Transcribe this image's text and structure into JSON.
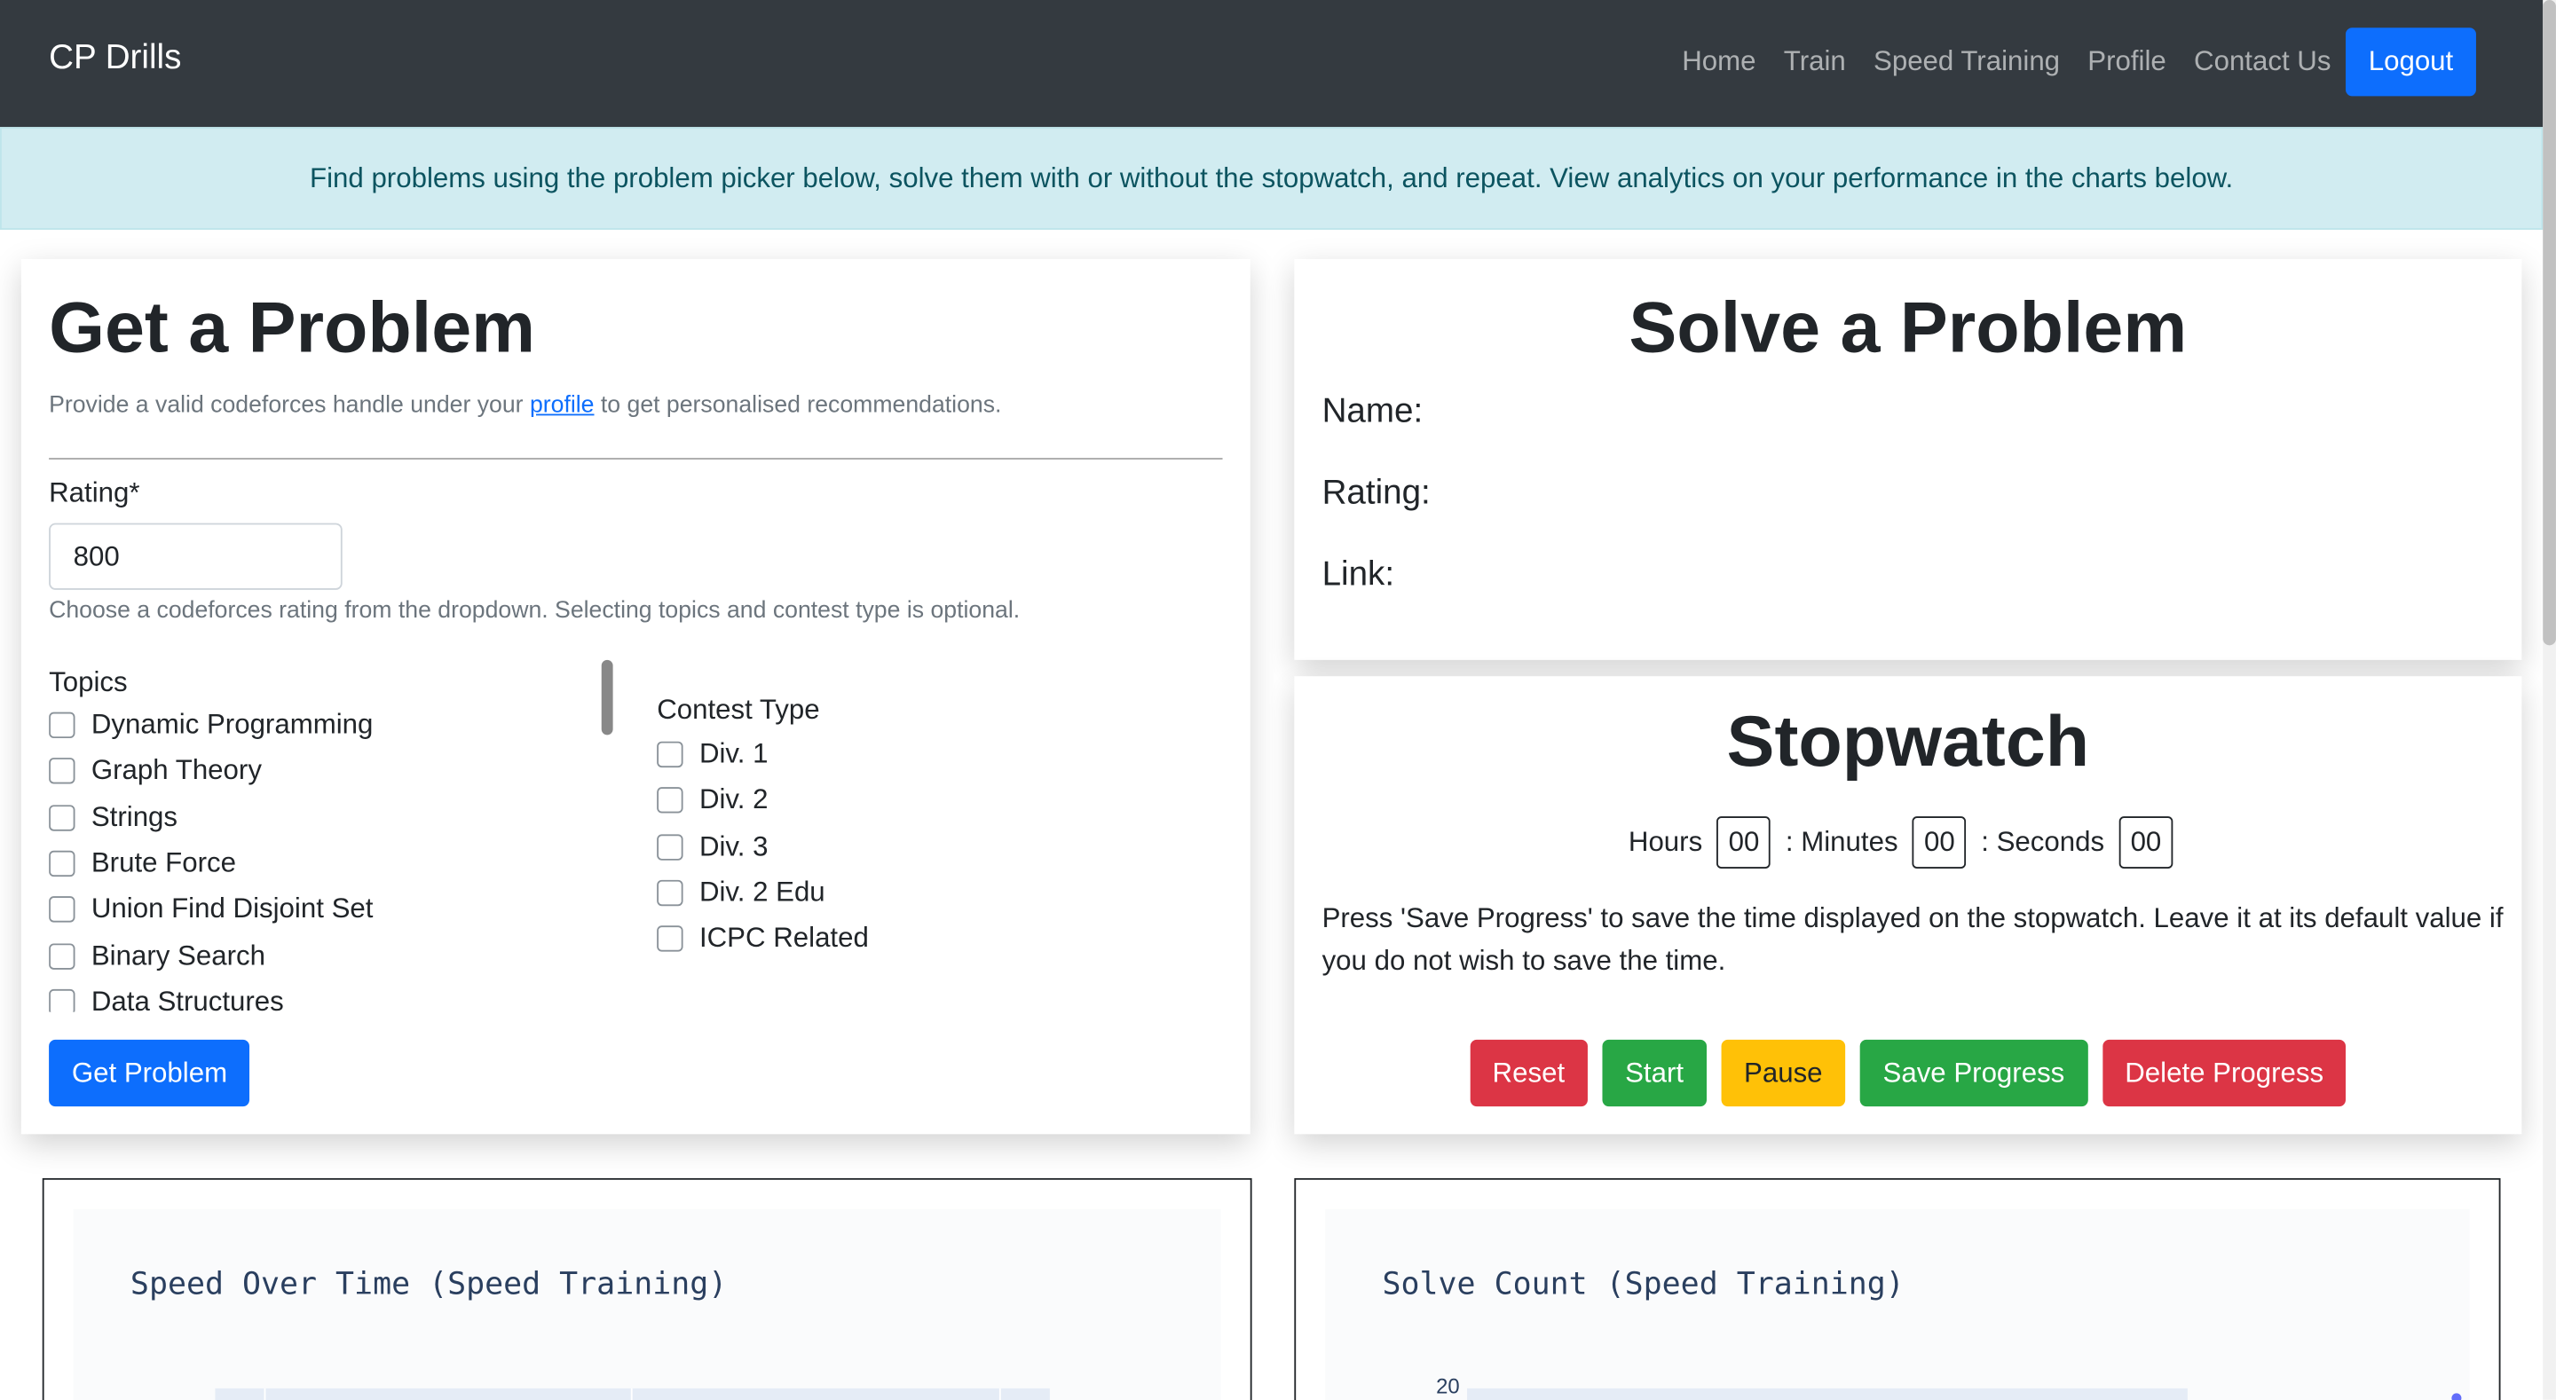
{
  "navbar": {
    "brand": "CP Drills",
    "links": [
      "Home",
      "Train",
      "Speed Training",
      "Profile",
      "Contact Us"
    ],
    "logout_label": "Logout"
  },
  "alert": {
    "text": "Find problems using the problem picker below, solve them with or without the stopwatch, and repeat. View analytics on your performance in the charts below."
  },
  "get_problem": {
    "title": "Get a Problem",
    "subtitle_before": "Provide a valid codeforces handle under your ",
    "subtitle_link": "profile",
    "subtitle_after": " to get personalised recommendations.",
    "rating_label": "Rating*",
    "rating_value": "800",
    "rating_help": "Choose a codeforces rating from the dropdown. Selecting topics and contest type is optional.",
    "topics_label": "Topics",
    "topics": [
      "Dynamic Programming",
      "Graph Theory",
      "Strings",
      "Brute Force",
      "Union Find Disjoint Set",
      "Binary Search",
      "Data Structures"
    ],
    "contest_label": "Contest Type",
    "contest_types": [
      "Div. 1",
      "Div. 2",
      "Div. 3",
      "Div. 2 Edu",
      "ICPC Related"
    ],
    "button_label": "Get Problem"
  },
  "solve_problem": {
    "title": "Solve a Problem",
    "name_label": "Name:",
    "rating_label": "Rating:",
    "link_label": "Link:"
  },
  "stopwatch": {
    "title": "Stopwatch",
    "hours_label": "Hours",
    "hours": "00",
    "minutes_label": ": Minutes",
    "minutes": "00",
    "seconds_label": ": Seconds",
    "seconds": "00",
    "description": "Press 'Save Progress' to save the time displayed on the stopwatch. Leave it at its default value if you do not wish to save the time.",
    "buttons": {
      "reset": "Reset",
      "start": "Start",
      "pause": "Pause",
      "save": "Save Progress",
      "delete": "Delete Progress"
    }
  },
  "charts": [
    {
      "title": "Speed Over Time (Speed Training)"
    },
    {
      "title": "Solve Count (Speed Training)",
      "y_tick_top": "20"
    }
  ],
  "colors": {
    "navbar_bg": "#343a40",
    "primary": "#0d6efd",
    "danger": "#dc3545",
    "success": "#28a745",
    "warning": "#ffc107",
    "alert_bg": "#d1ecf1"
  }
}
